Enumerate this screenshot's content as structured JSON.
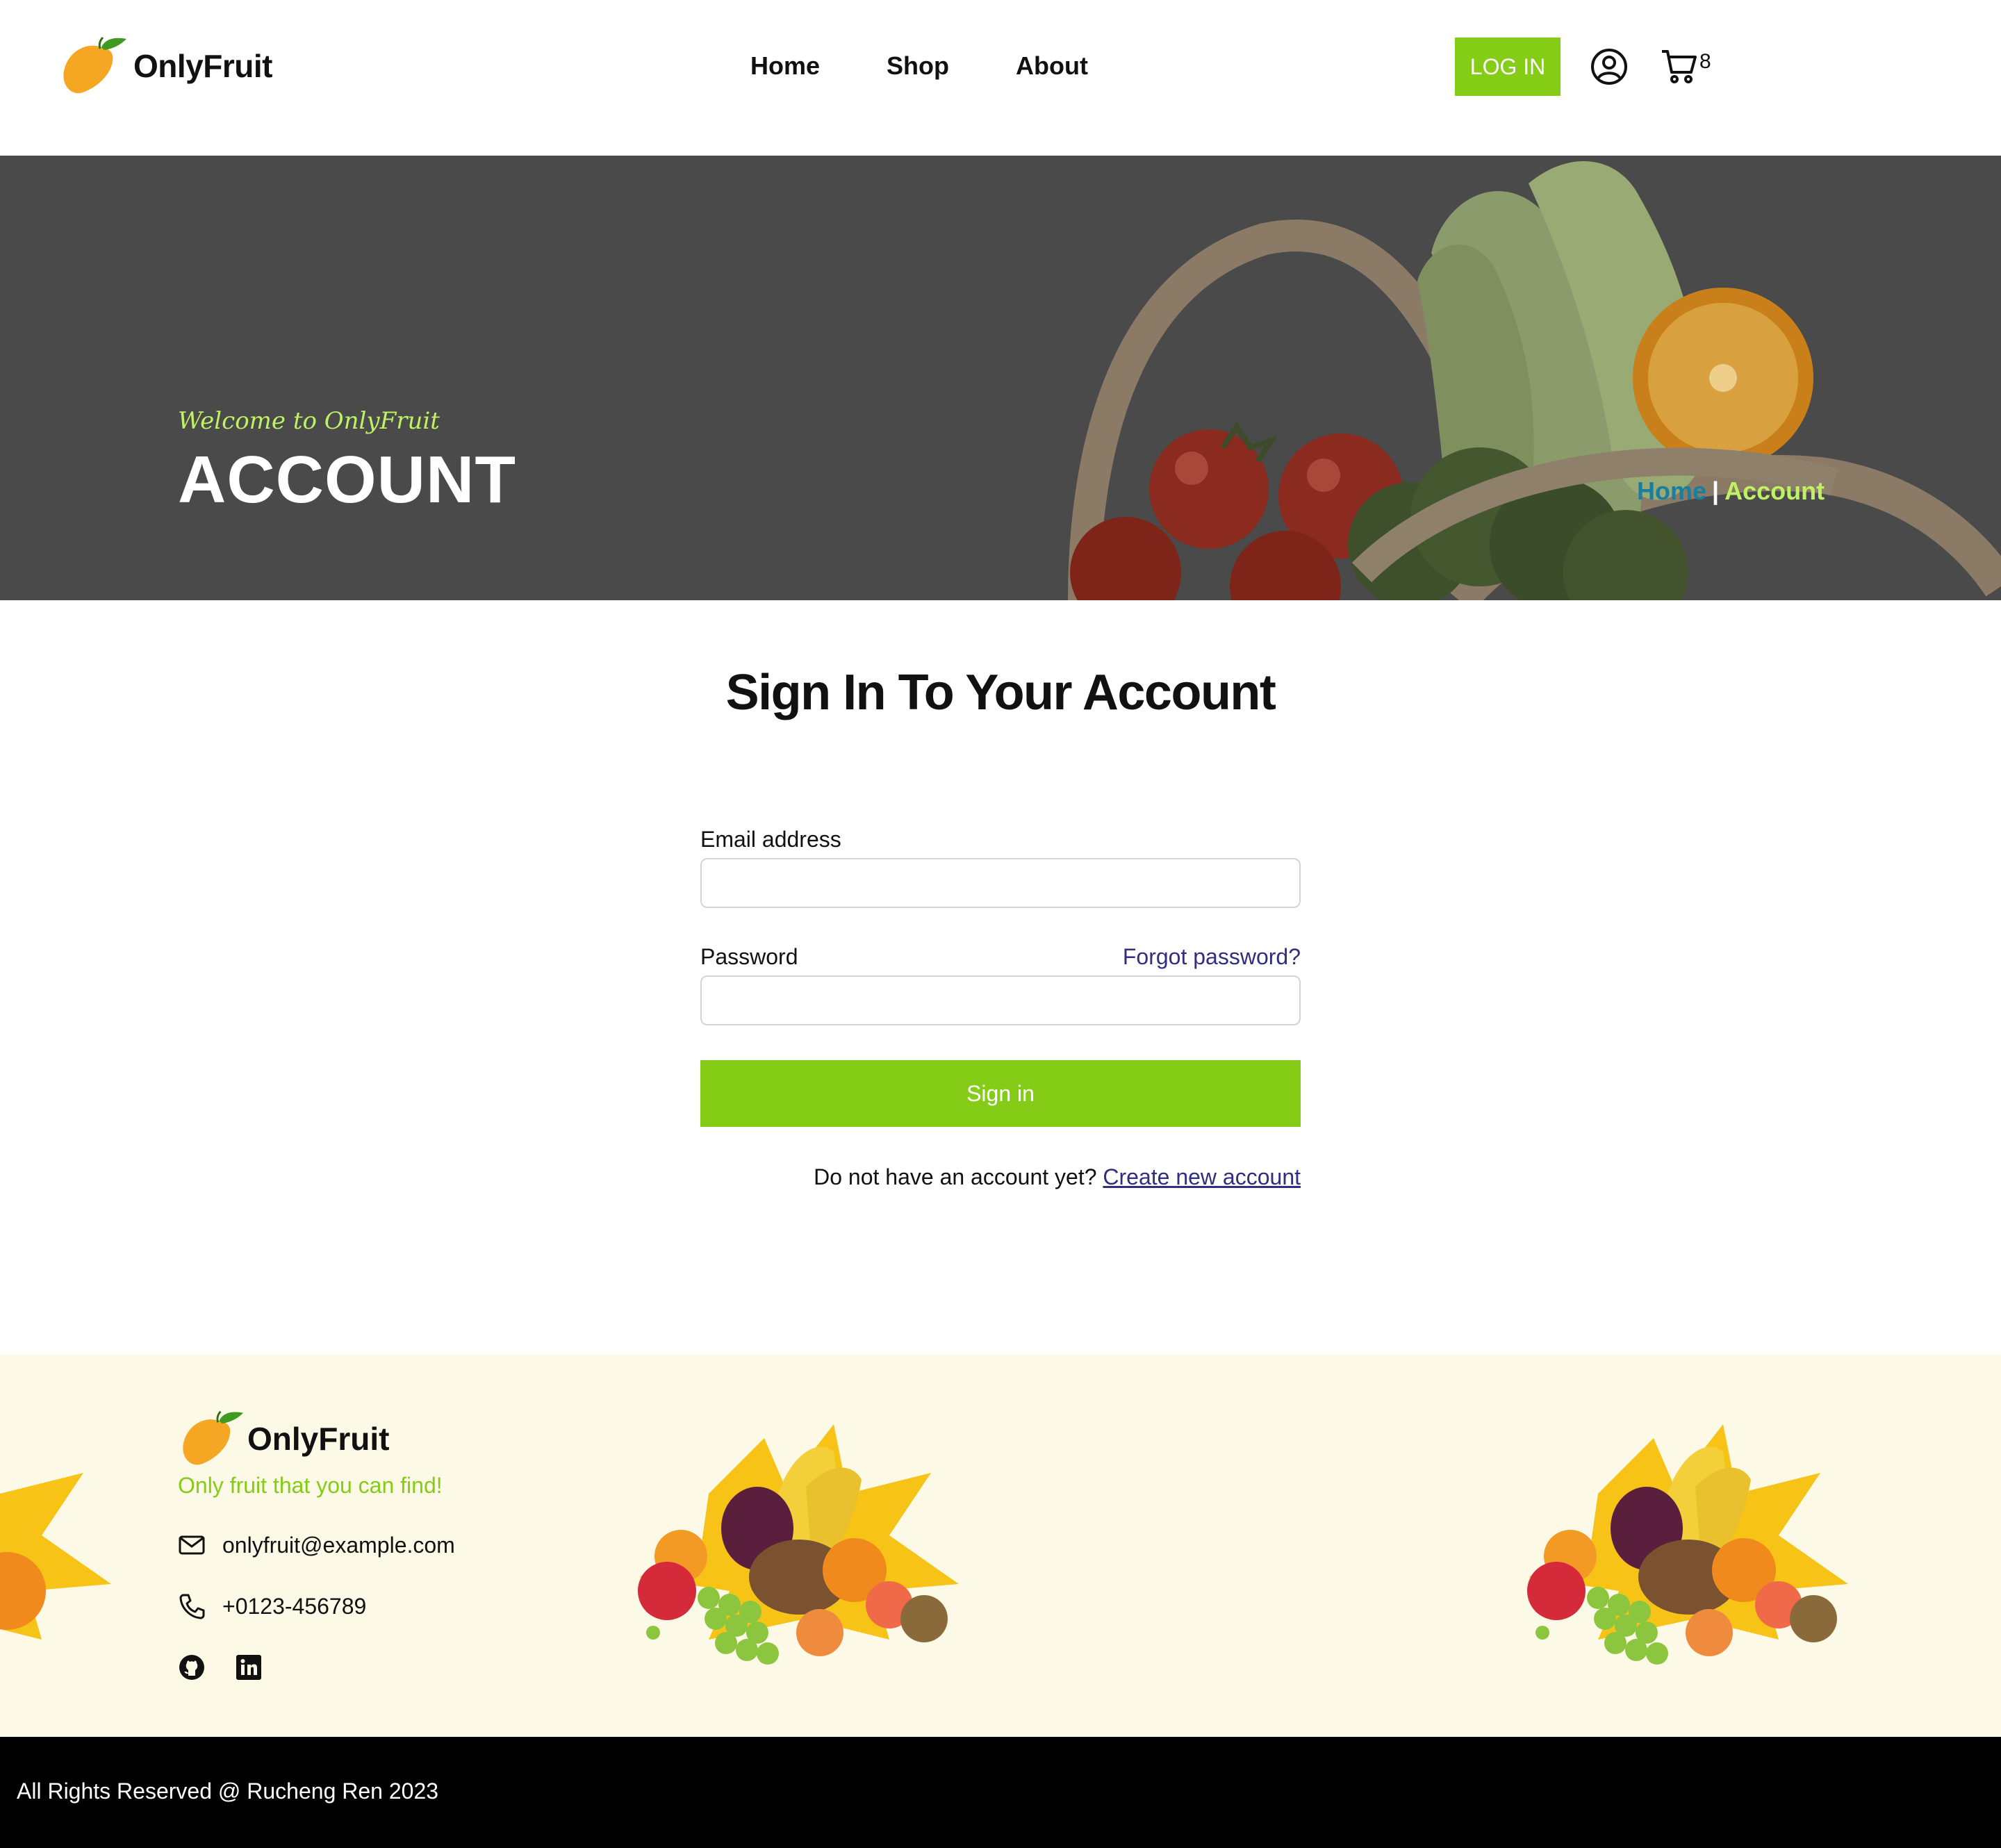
{
  "brand": {
    "name": "OnlyFruit"
  },
  "nav": {
    "items": [
      {
        "label": "Home"
      },
      {
        "label": "Shop"
      },
      {
        "label": "About"
      }
    ]
  },
  "header": {
    "login_label": "LOG IN",
    "cart_count": "8",
    "user_icon": "user-circle-icon",
    "cart_icon": "cart-icon"
  },
  "hero": {
    "subtitle": "Welcome to OnlyFruit",
    "title": "ACCOUNT",
    "breadcrumb": {
      "home": "Home",
      "separator": "|",
      "current": "Account"
    }
  },
  "signin": {
    "title": "Sign In To Your Account",
    "email_label": "Email address",
    "email_value": "",
    "password_label": "Password",
    "password_value": "",
    "forgot_label": "Forgot password?",
    "submit_label": "Sign in",
    "no_account_text": "Do not have an account yet?",
    "create_label": "Create new account"
  },
  "footer": {
    "brand_name": "OnlyFruit",
    "tagline": "Only fruit that you can find!",
    "email": "onlyfruit@example.com",
    "phone": "+0123-456789",
    "social": [
      "github-icon",
      "linkedin-icon"
    ],
    "copyright": "All Rights Reserved @ Rucheng Ren 2023"
  },
  "colors": {
    "accent": "#84cc16",
    "hero_overlay": "#4a4a4a",
    "footer_bg": "#fdf9e7",
    "link": "#312e81",
    "crumb_home": "#1a7ea0",
    "crumb_current": "#bef264"
  }
}
